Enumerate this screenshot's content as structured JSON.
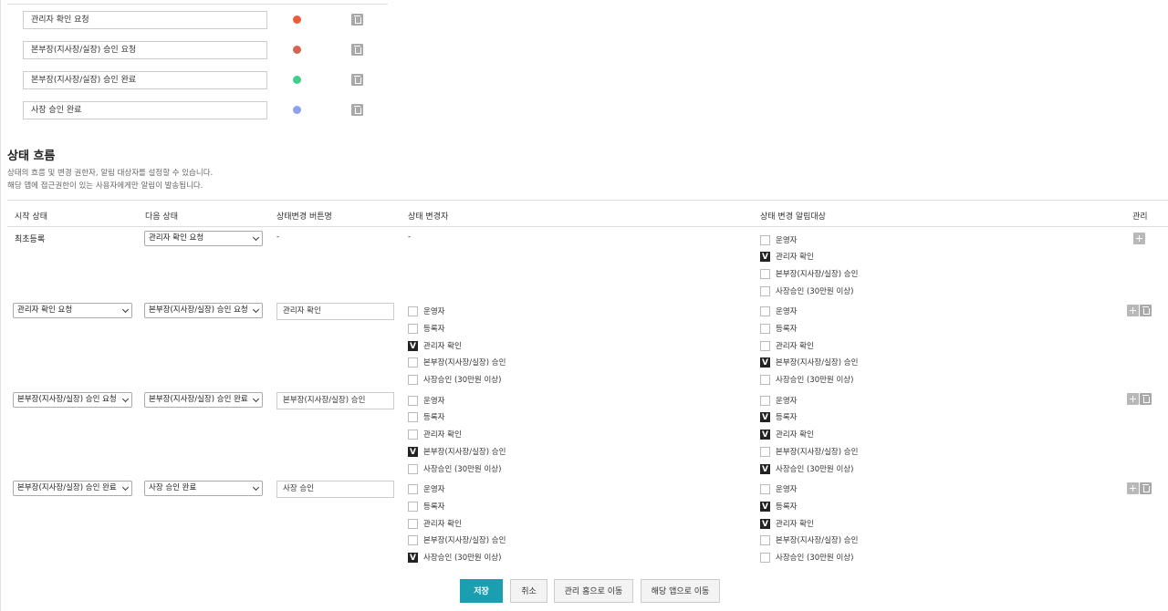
{
  "statuses": [
    {
      "name": "관리자 확인 요청",
      "color": "#f05a3a"
    },
    {
      "name": "본부장(지사장/실장) 승인 요청",
      "color": "#d4644f"
    },
    {
      "name": "본부장(지사장/실장) 승인 완료",
      "color": "#3ccf8e"
    },
    {
      "name": "사장 승인 완료",
      "color": "#8fa0f0"
    }
  ],
  "flow": {
    "title": "상태 흐름",
    "desc1": "상태의 흐름 및 변경 권한자, 알림 대상자를 설정할 수 있습니다.",
    "desc2": "해당 앱에 접근권한이 있는 사용자에게만 알림이 발송됩니다.",
    "headers": {
      "start": "시작 상태",
      "next": "다음 상태",
      "button": "상태변경 버튼명",
      "changer": "상태 변경자",
      "notify": "상태 변경 알림대상",
      "manage": "관리"
    },
    "rows": [
      {
        "start": "최초등록",
        "next": "관리자 확인 요청",
        "button": "-",
        "changer_dash": "-",
        "notify": [
          {
            "label": "운영자",
            "checked": false
          },
          {
            "label": "관리자 확인",
            "checked": true
          },
          {
            "label": "본부장(지사장/실장) 승인",
            "checked": false
          },
          {
            "label": "사장승인 (30만원 이상)",
            "checked": false
          }
        ]
      },
      {
        "start": "관리자 확인 요청",
        "next": "본부장(지사장/실장) 승인 요청",
        "button": "관리자 확인",
        "changers": [
          {
            "label": "운영자",
            "checked": false
          },
          {
            "label": "등록자",
            "checked": false
          },
          {
            "label": "관리자 확인",
            "checked": true
          },
          {
            "label": "본부장(지사장/실장) 승인",
            "checked": false
          },
          {
            "label": "사장승인 (30만원 이상)",
            "checked": false
          }
        ],
        "notify": [
          {
            "label": "운영자",
            "checked": false
          },
          {
            "label": "등록자",
            "checked": false
          },
          {
            "label": "관리자 확인",
            "checked": false
          },
          {
            "label": "본부장(지사장/실장) 승인",
            "checked": true
          },
          {
            "label": "사장승인 (30만원 이상)",
            "checked": false
          }
        ]
      },
      {
        "start": "본부장(지사장/실장) 승인 요청",
        "next": "본부장(지사장/실장) 승인 완료",
        "button": "본부장(지사장/실장) 승인",
        "changers": [
          {
            "label": "운영자",
            "checked": false
          },
          {
            "label": "등록자",
            "checked": false
          },
          {
            "label": "관리자 확인",
            "checked": false
          },
          {
            "label": "본부장(지사장/실장) 승인",
            "checked": true
          },
          {
            "label": "사장승인 (30만원 이상)",
            "checked": false
          }
        ],
        "notify": [
          {
            "label": "운영자",
            "checked": false
          },
          {
            "label": "등록자",
            "checked": true
          },
          {
            "label": "관리자 확인",
            "checked": true
          },
          {
            "label": "본부장(지사장/실장) 승인",
            "checked": false
          },
          {
            "label": "사장승인 (30만원 이상)",
            "checked": true
          }
        ]
      },
      {
        "start": "본부장(지사장/실장) 승인 완료",
        "next": "사장 승인 완료",
        "button": "사장 승인",
        "changers": [
          {
            "label": "운영자",
            "checked": false
          },
          {
            "label": "등록자",
            "checked": false
          },
          {
            "label": "관리자 확인",
            "checked": false
          },
          {
            "label": "본부장(지사장/실장) 승인",
            "checked": false
          },
          {
            "label": "사장승인 (30만원 이상)",
            "checked": true
          }
        ],
        "notify": [
          {
            "label": "운영자",
            "checked": false
          },
          {
            "label": "등록자",
            "checked": true
          },
          {
            "label": "관리자 확인",
            "checked": true
          },
          {
            "label": "본부장(지사장/실장) 승인",
            "checked": false
          },
          {
            "label": "사장승인 (30만원 이상)",
            "checked": false
          }
        ]
      }
    ]
  },
  "buttons": {
    "save": "저장",
    "cancel": "취소",
    "manage_home": "관리 홈으로 이동",
    "app": "해당 앱으로 이동"
  }
}
